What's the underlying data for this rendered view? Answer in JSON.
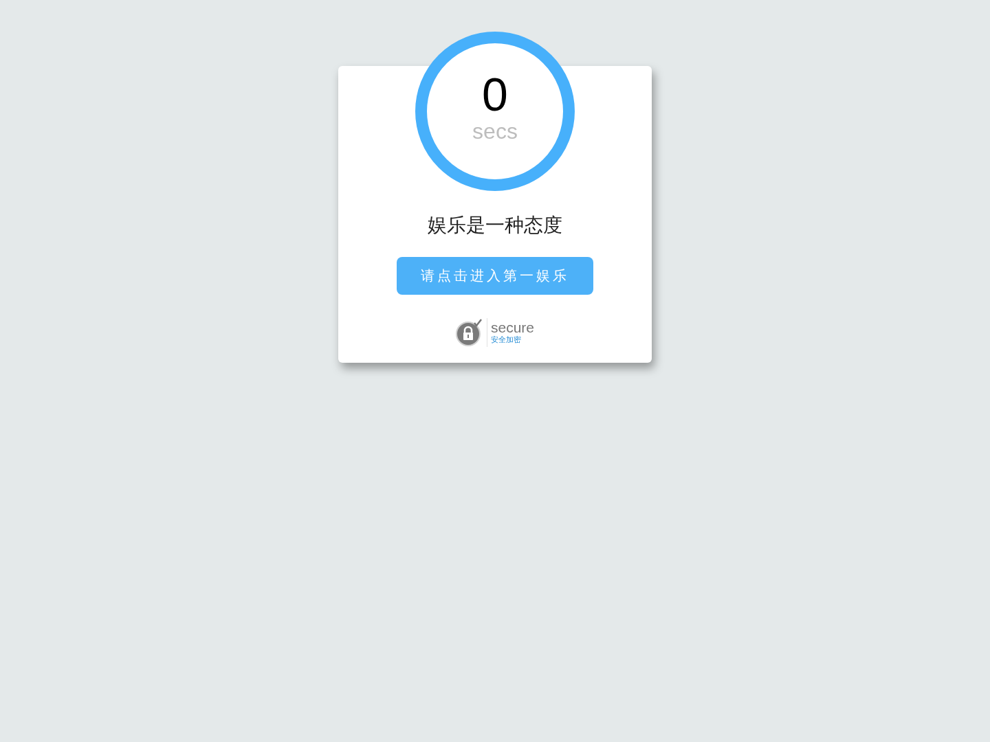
{
  "countdown": {
    "value": "0",
    "unit": "secs"
  },
  "slogan": "娱乐是一种态度",
  "button": "请点击进入第一娱乐",
  "secure_badge": {
    "title": "secure",
    "subtitle": "安全加密"
  }
}
